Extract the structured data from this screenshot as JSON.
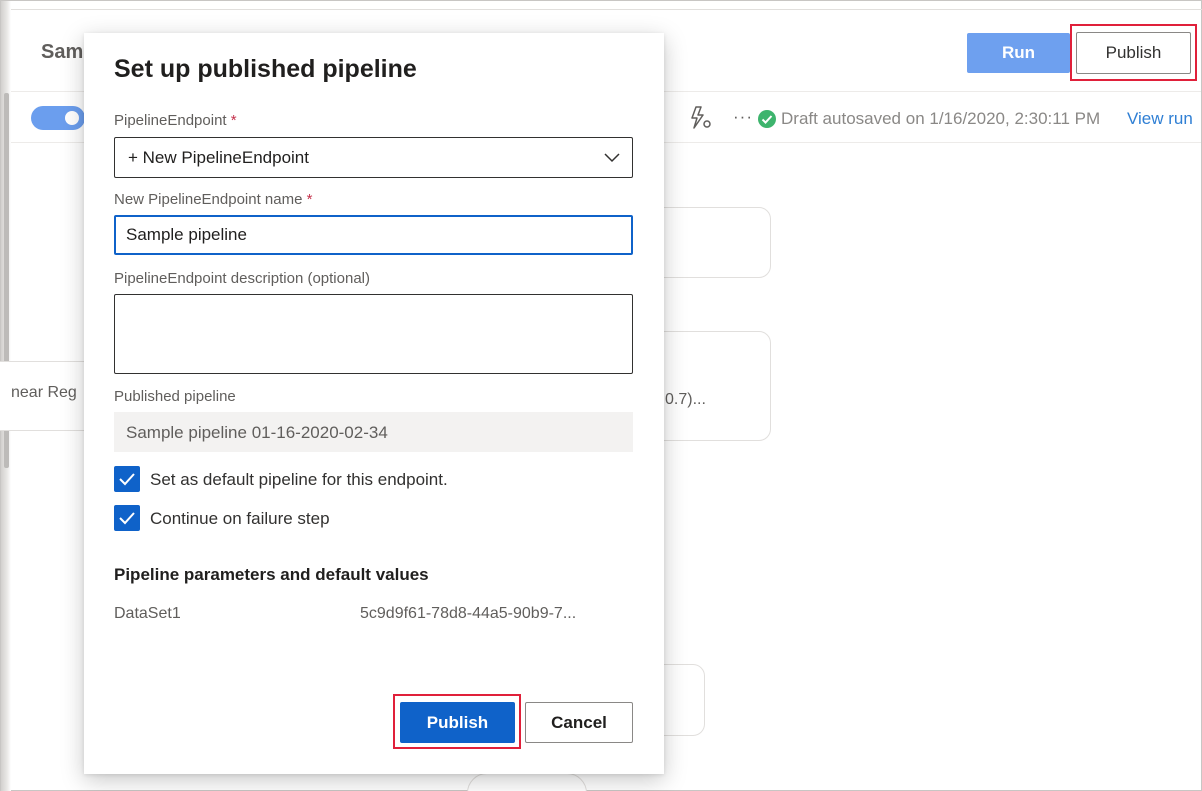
{
  "background": {
    "page_title": "Samp",
    "run_label": "Run",
    "publish_label": "Publish",
    "autosave_text": "Draft autosaved on 1/16/2020, 2:30:11 PM",
    "view_run_label": "View run",
    "left_node_text": "near Reg",
    "right_node_text": "0.7)..."
  },
  "dialog": {
    "title": "Set up published pipeline",
    "endpoint_label": "PipelineEndpoint",
    "endpoint_value": "+ New PipelineEndpoint",
    "name_label": "New PipelineEndpoint name",
    "name_value": "Sample pipeline",
    "description_label": "PipelineEndpoint description (optional)",
    "description_value": "",
    "published_label": "Published pipeline",
    "published_value": "Sample pipeline 01-16-2020-02-34",
    "default_checkbox_label": "Set as default pipeline for this endpoint.",
    "default_checked": true,
    "continue_checkbox_label": "Continue on failure step",
    "continue_checked": true,
    "params_title": "Pipeline parameters and default values",
    "params": [
      {
        "name": "DataSet1",
        "value": "5c9d9f61-78d8-44a5-90b9-7..."
      }
    ],
    "publish_label": "Publish",
    "cancel_label": "Cancel",
    "required_marker": "*"
  },
  "colors": {
    "accent": "#0f62c9",
    "run_button": "#6ea0ef",
    "highlight": "#e0203a",
    "success": "#3db46d"
  },
  "icons": [
    "chevron-down-icon",
    "checkmark-icon",
    "success-check-icon",
    "wand-settings-icon",
    "more-icon"
  ]
}
